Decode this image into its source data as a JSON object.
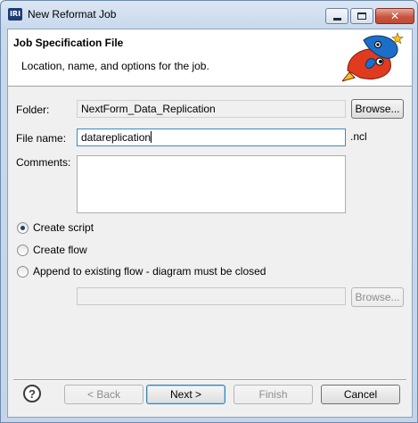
{
  "window": {
    "title": "New Reformat Job",
    "app_icon_text": "IRI",
    "close_glyph": "✕"
  },
  "header": {
    "title": "Job Specification File",
    "description": "Location, name, and options for the job.",
    "image_icon": "fish-logo-icon"
  },
  "form": {
    "folder_label": "Folder:",
    "folder_value": "NextForm_Data_Replication",
    "folder_browse": "Browse...",
    "filename_label": "File name:",
    "filename_value": "datareplication",
    "filename_ext": ".ncl",
    "comments_label": "Comments:",
    "comments_value": ""
  },
  "options": {
    "create_script": "Create script",
    "create_flow": "Create flow",
    "append_flow": "Append to existing flow - diagram must be closed",
    "selected": "create_script",
    "flow_path_value": "",
    "flow_browse": "Browse..."
  },
  "footer": {
    "help_glyph": "?",
    "back": "< Back",
    "next": "Next >",
    "finish": "Finish",
    "cancel": "Cancel"
  },
  "colors": {
    "window_frame": "#c4d5e9",
    "close_button": "#c8553f",
    "fish_red": "#e03b1f",
    "fish_blue": "#1b6fc9",
    "fish_yellow": "#f6c417"
  }
}
